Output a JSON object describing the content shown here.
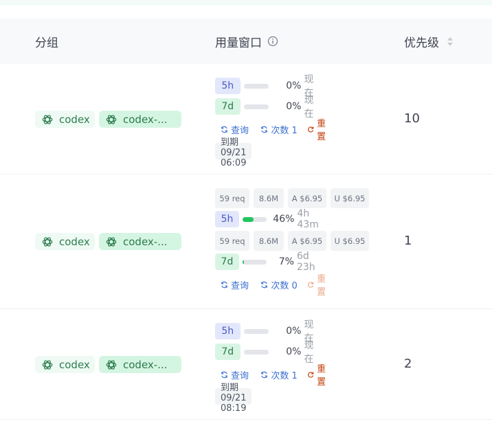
{
  "header": {
    "group": "分组",
    "window": "用量窗口",
    "priority": "优先级"
  },
  "icons": {
    "info": "info-circle-icon",
    "sort": "sort-icon",
    "openai": "openai-logo-icon",
    "refresh": "refresh-icon",
    "reset": "reset-icon"
  },
  "colors": {
    "progress_fill": "#22c55e",
    "tag_text": "#2e7d50",
    "link_blue": "#3b6fd1",
    "reset_orange": "#c2410c"
  },
  "rows": [
    {
      "tags": [
        "codex",
        "codex-..."
      ],
      "w5h": {
        "label": "5h",
        "progress": 0,
        "pct": "0%",
        "when": "现在"
      },
      "w7d": {
        "label": "7d",
        "progress": 0,
        "pct": "0%",
        "when": "现在"
      },
      "actions": {
        "query": "查询",
        "count": "次数 1",
        "reset": "重置"
      },
      "expiry": "到期 09/21 06:09",
      "priority": "10"
    },
    {
      "tags": [
        "codex",
        "codex-..."
      ],
      "stats5h": [
        "59 req",
        "8.6M",
        "A $6.95",
        "U $6.95"
      ],
      "w5h": {
        "label": "5h",
        "progress": 0.46,
        "pct": "46%",
        "when": "4h 43m"
      },
      "stats7d": [
        "59 req",
        "8.6M",
        "A $6.95",
        "U $6.95"
      ],
      "w7d": {
        "label": "7d",
        "progress": 0.07,
        "pct": "7%",
        "when": "6d 23h"
      },
      "actions": {
        "query": "查询",
        "count": "次数 0",
        "reset": "重置"
      },
      "priority": "1"
    },
    {
      "tags": [
        "codex",
        "codex-..."
      ],
      "w5h": {
        "label": "5h",
        "progress": 0,
        "pct": "0%",
        "when": "现在"
      },
      "w7d": {
        "label": "7d",
        "progress": 0,
        "pct": "0%",
        "when": "现在"
      },
      "actions": {
        "query": "查询",
        "count": "次数 1",
        "reset": "重置"
      },
      "expiry": "到期 09/21 08:19",
      "priority": "2"
    }
  ]
}
